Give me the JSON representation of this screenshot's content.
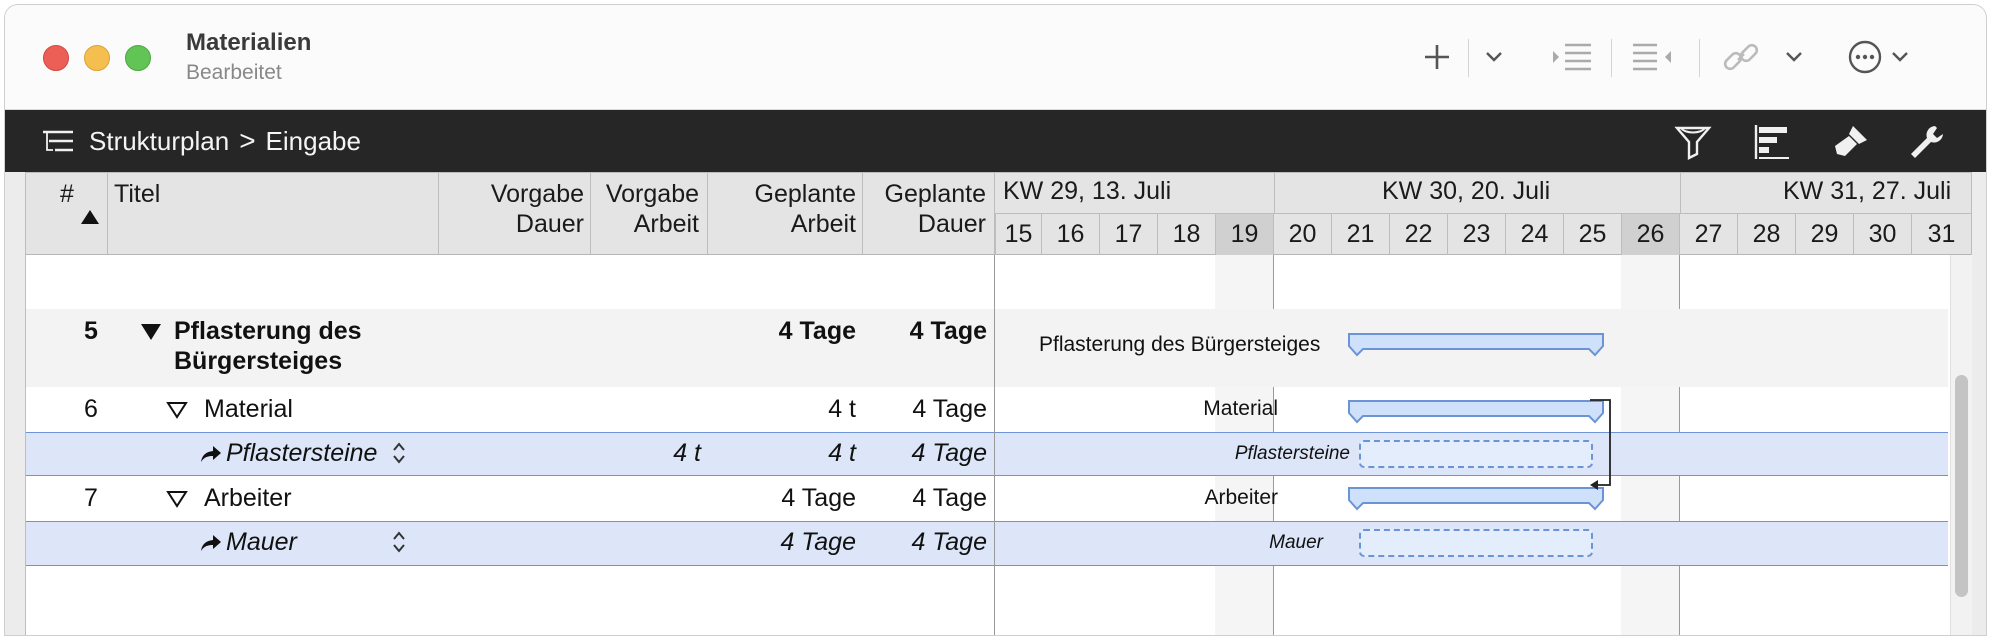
{
  "window": {
    "title": "Materialien",
    "subtitle": "Bearbeitet"
  },
  "breadcrumb": {
    "root": "Strukturplan",
    "separator": ">",
    "current": "Eingabe"
  },
  "columns": {
    "num": "#",
    "title": "Titel",
    "vorgabe_dauer": [
      "Vorgabe",
      "Dauer"
    ],
    "vorgabe_arbeit": [
      "Vorgabe",
      "Arbeit"
    ],
    "geplante_arbeit": [
      "Geplante",
      "Arbeit"
    ],
    "geplante_dauer": [
      "Geplante",
      "Dauer"
    ]
  },
  "timeline": {
    "weeks": [
      "KW 29, 13. Juli",
      "KW 30, 20. Juli",
      "KW 31, 27. Juli"
    ],
    "days": [
      "15",
      "16",
      "17",
      "18",
      "19",
      "20",
      "21",
      "22",
      "23",
      "24",
      "25",
      "26",
      "27",
      "28",
      "29",
      "30",
      "31"
    ]
  },
  "rows": [
    {
      "num": "5",
      "title_line1": "Pflasterung des",
      "title_line2": "Bürgersteiges",
      "geplante_arbeit": "4 Tage",
      "geplante_dauer": "4 Tage",
      "gantt_label": "Pflasterung des Bürgersteiges"
    },
    {
      "num": "6",
      "title": "Material",
      "geplante_arbeit": "4 t",
      "geplante_dauer": "4 Tage",
      "gantt_label": "Material"
    },
    {
      "title": "Pflastersteine",
      "vorgabe_arbeit": "4 t",
      "geplante_arbeit": "4 t",
      "geplante_dauer": "4 Tage",
      "gantt_label": "Pflastersteine"
    },
    {
      "num": "7",
      "title": "Arbeiter",
      "geplante_arbeit": "4 Tage",
      "geplante_dauer": "4 Tage",
      "gantt_label": "Arbeiter"
    },
    {
      "title": "Mauer",
      "geplante_arbeit": "4 Tage",
      "geplante_dauer": "4 Tage",
      "gantt_label": "Mauer"
    }
  ],
  "icons": {
    "add": "plus-icon",
    "indent": "indent-icon",
    "outdent": "outdent-icon",
    "link": "link-icon",
    "more": "ellipsis-icon",
    "filter": "filter-icon",
    "gantt": "gantt-icon",
    "style": "brush-icon",
    "tools": "wrench-icon"
  },
  "colors": {
    "bar_fill": "#cfe0fb",
    "bar_stroke": "#6b94d6",
    "selection": "#dce6f8",
    "toolbar_dark": "#262626"
  }
}
